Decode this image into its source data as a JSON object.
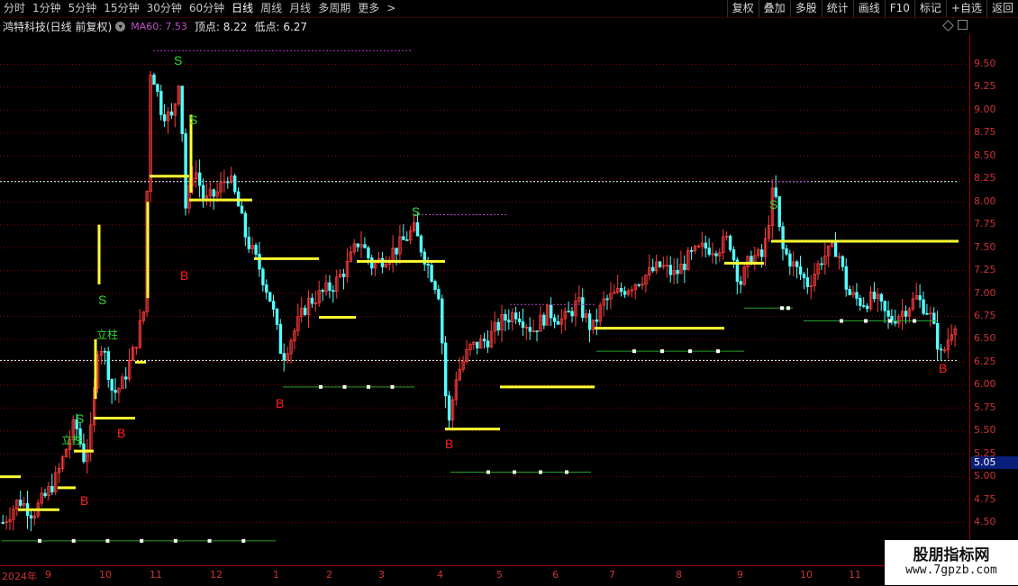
{
  "toolbar": {
    "timeframes": [
      "分时",
      "1分钟",
      "5分钟",
      "15分钟",
      "30分钟",
      "60分钟",
      "日线",
      "周线",
      "月线",
      "多周期",
      "更多"
    ],
    "active_timeframe": "日线",
    "more_arrow": ">",
    "tools": [
      "复权",
      "叠加",
      "多股",
      "统计",
      "画线",
      "F10",
      "标记",
      "+自选",
      "返回"
    ]
  },
  "info": {
    "title": "鸿特科技(日线 前复权)",
    "ma": "MA60: 7.53",
    "peak": "顶点: 8.22",
    "low": "低点: 6.27"
  },
  "price_axis": {
    "labels": [
      "9.50",
      "9.25",
      "9.00",
      "8.75",
      "8.50",
      "8.25",
      "8.00",
      "7.75",
      "7.50",
      "7.25",
      "7.00",
      "6.75",
      "6.50",
      "6.25",
      "6.00",
      "5.75",
      "5.50",
      "5.25",
      "5.00",
      "4.75",
      "4.50"
    ],
    "current_price": "5.05"
  },
  "date_axis": {
    "labels": [
      "2024年",
      "9",
      "10",
      "11",
      "12",
      "1",
      "2",
      "3",
      "4",
      "5",
      "6",
      "7",
      "8",
      "9",
      "10",
      "11"
    ]
  },
  "annotations": {
    "sell": "S",
    "buy": "B",
    "pillar": "立柱"
  },
  "watermark": {
    "title": "股朋指标网",
    "url": "www.7gpzb.com"
  },
  "colors": {
    "up": "#ff3b3b",
    "down": "#54ffff",
    "support": "#ffff33",
    "sell_label": "#33dd33",
    "buy_label": "#ff2020",
    "grid": "#8a0000"
  }
}
